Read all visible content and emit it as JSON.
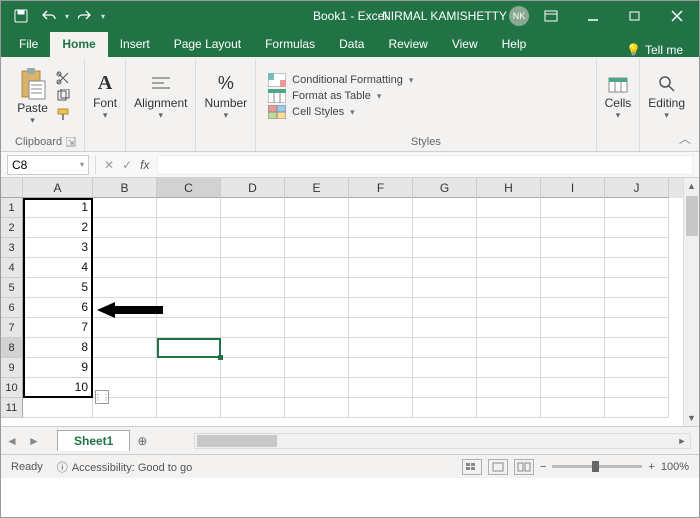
{
  "titlebar": {
    "doc_title": "Book1 - Excel",
    "user_name": "NIRMAL KAMISHETTY",
    "user_initials": "NK"
  },
  "tabs": {
    "file": "File",
    "home": "Home",
    "insert": "Insert",
    "page_layout": "Page Layout",
    "formulas": "Formulas",
    "data": "Data",
    "review": "Review",
    "view": "View",
    "help": "Help",
    "tellme": "Tell me"
  },
  "ribbon": {
    "paste": "Paste",
    "clipboard": "Clipboard",
    "font": "Font",
    "alignment": "Alignment",
    "number": "Number",
    "cf": "Conditional Formatting",
    "fat": "Format as Table",
    "cs": "Cell Styles",
    "styles": "Styles",
    "cells": "Cells",
    "editing": "Editing"
  },
  "namebox": {
    "value": "C8"
  },
  "formula_bar": {
    "fx": "fx",
    "value": ""
  },
  "columns": [
    "A",
    "B",
    "C",
    "D",
    "E",
    "F",
    "G",
    "H",
    "I",
    "J"
  ],
  "rows": [
    "1",
    "2",
    "3",
    "4",
    "5",
    "6",
    "7",
    "8",
    "9",
    "10",
    "11"
  ],
  "col_A_values": [
    "1",
    "2",
    "3",
    "4",
    "5",
    "6",
    "7",
    "8",
    "9",
    "10",
    ""
  ],
  "active_cell": {
    "col": "C",
    "row": 8
  },
  "sheet": {
    "name": "Sheet1",
    "add": "+"
  },
  "status": {
    "ready": "Ready",
    "accessibility": "Accessibility: Good to go",
    "zoom_pct": "100%",
    "minus": "−",
    "plus": "+"
  },
  "colors": {
    "brand": "#217346"
  }
}
